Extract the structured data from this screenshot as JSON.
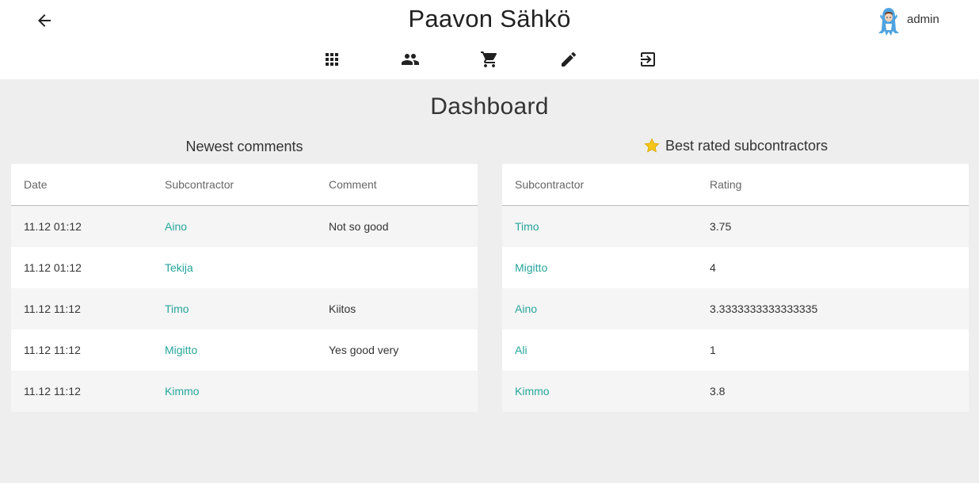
{
  "header": {
    "title": "Paavon Sähkö",
    "username": "admin",
    "back_icon": "arrow-left-icon",
    "nav": [
      {
        "icon": "apps-icon"
      },
      {
        "icon": "people-icon"
      },
      {
        "icon": "shopping-cart-icon"
      },
      {
        "icon": "edit-pencil-icon"
      },
      {
        "icon": "logout-icon"
      }
    ]
  },
  "dashboard": {
    "title": "Dashboard",
    "comments": {
      "title": "Newest comments",
      "columns": [
        "Date",
        "Subcontractor",
        "Comment"
      ],
      "rows": [
        {
          "date": "11.12 01:12",
          "subcontractor": "Aino",
          "comment": "Not so good"
        },
        {
          "date": "11.12 01:12",
          "subcontractor": "Tekija",
          "comment": ""
        },
        {
          "date": "11.12 11:12",
          "subcontractor": "Timo",
          "comment": "Kiitos"
        },
        {
          "date": "11.12 11:12",
          "subcontractor": "Migitto",
          "comment": "Yes good very"
        },
        {
          "date": "11.12 11:12",
          "subcontractor": "Kimmo",
          "comment": ""
        }
      ]
    },
    "best_rated": {
      "title": "Best rated subcontractors",
      "icon": "star-icon",
      "columns": [
        "Subcontractor",
        "Rating"
      ],
      "rows": [
        {
          "subcontractor": "Timo",
          "rating": "3.75"
        },
        {
          "subcontractor": "Migitto",
          "rating": "4"
        },
        {
          "subcontractor": "Aino",
          "rating": "3.3333333333333335"
        },
        {
          "subcontractor": "Ali",
          "rating": "1"
        },
        {
          "subcontractor": "Kimmo",
          "rating": "3.8"
        }
      ]
    }
  },
  "colors": {
    "link": "#26a69a",
    "header_bg": "#ffffff",
    "page_bg": "#eeeeee",
    "striped_row": "#f5f5f5"
  }
}
